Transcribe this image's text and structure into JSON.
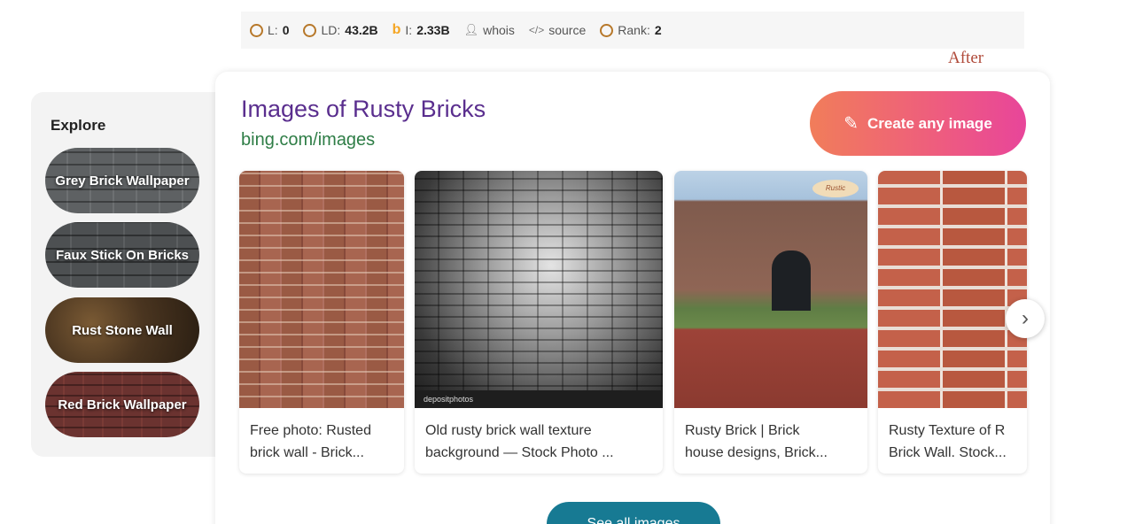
{
  "seo_bar": {
    "l_label": "L:",
    "l_value": "0",
    "ld_label": "LD:",
    "ld_value": "43.2B",
    "i_label": "I:",
    "i_value": "2.33B",
    "whois": "whois",
    "source": "source",
    "rank_label": "Rank:",
    "rank_value": "2"
  },
  "annotation": "After",
  "explore": {
    "title": "Explore",
    "items": [
      {
        "label": "Grey Brick Wallpaper"
      },
      {
        "label": "Faux Stick On Bricks"
      },
      {
        "label": "Rust Stone Wall"
      },
      {
        "label": "Red Brick Wallpaper"
      }
    ]
  },
  "card": {
    "title": "Images of Rusty Bricks",
    "url": "bing.com/images",
    "create_button": "Create any image",
    "see_more": "See all images",
    "tiles": [
      {
        "line1": "Free photo: Rusted",
        "line2": "brick wall - Brick..."
      },
      {
        "line1": "Old rusty brick wall texture",
        "line2": "background — Stock Photo ...",
        "watermark": "depositphotos"
      },
      {
        "line1": "Rusty Brick | Brick",
        "line2": "house designs, Brick...",
        "logo": "Rustic"
      },
      {
        "line1": "Rusty Texture of R",
        "line2": "Brick Wall. Stock..."
      }
    ]
  },
  "colors": {
    "title_purple": "#5a2e8e",
    "url_green": "#2e7d46",
    "create_gradient_start": "#f17d5a",
    "create_gradient_end": "#e8459a",
    "see_more_teal": "#177a93"
  }
}
